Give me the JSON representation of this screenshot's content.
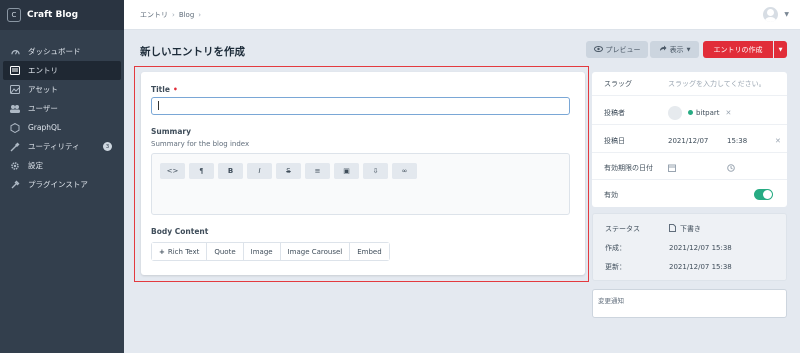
{
  "brand": {
    "logo_letter": "C",
    "name": "Craft Blog"
  },
  "nav": [
    {
      "icon": "dashboard-icon",
      "label": "ダッシュボード"
    },
    {
      "icon": "entries-icon",
      "label": "エントリ"
    },
    {
      "icon": "assets-icon",
      "label": "アセット"
    },
    {
      "icon": "users-icon",
      "label": "ユーザー"
    },
    {
      "icon": "graphql-icon",
      "label": "GraphQL"
    },
    {
      "icon": "utilities-icon",
      "label": "ユーティリティ",
      "badge": "3"
    },
    {
      "icon": "settings-icon",
      "label": "設定"
    },
    {
      "icon": "plugin-store-icon",
      "label": "プラグインストア"
    }
  ],
  "breadcrumb": [
    "エントリ",
    "Blog"
  ],
  "page": {
    "title": "新しいエントリを作成",
    "preview_label": "プレビュー",
    "view_label": "表示",
    "create_label": "エントリの作成"
  },
  "fields": {
    "title_label": "Title",
    "title_value": "",
    "summary_label": "Summary",
    "summary_hint": "Summary for the blog index",
    "body_label": "Body Content",
    "rte_buttons": [
      "<>",
      "¶",
      "B",
      "I",
      "S",
      "≡",
      "▣",
      "⇩",
      "∞"
    ],
    "blocks": [
      "Rich Text",
      "Quote",
      "Image",
      "Image Carousel",
      "Embed"
    ]
  },
  "meta": {
    "slug_label": "スラッグ",
    "slug_placeholder": "スラッグを入力してください。",
    "author_label": "投稿者",
    "author_name": "bitpart",
    "post_date_label": "投稿日",
    "post_date": "2021/12/07",
    "post_time": "15:38",
    "expiry_label": "有効期限の日付",
    "enabled_label": "有効",
    "enabled": true
  },
  "status": {
    "status_label": "ステータス",
    "status_value": "下書き",
    "created_label": "作成：",
    "created_value": "2021/12/07 15:38",
    "updated_label": "更新：",
    "updated_value": "2021/12/07 15:38"
  },
  "notes": {
    "placeholder": "変更通知"
  },
  "colors": {
    "accent_red": "#e12d39",
    "sidebar": "#333f4d",
    "toggle_green": "#27ab83"
  }
}
